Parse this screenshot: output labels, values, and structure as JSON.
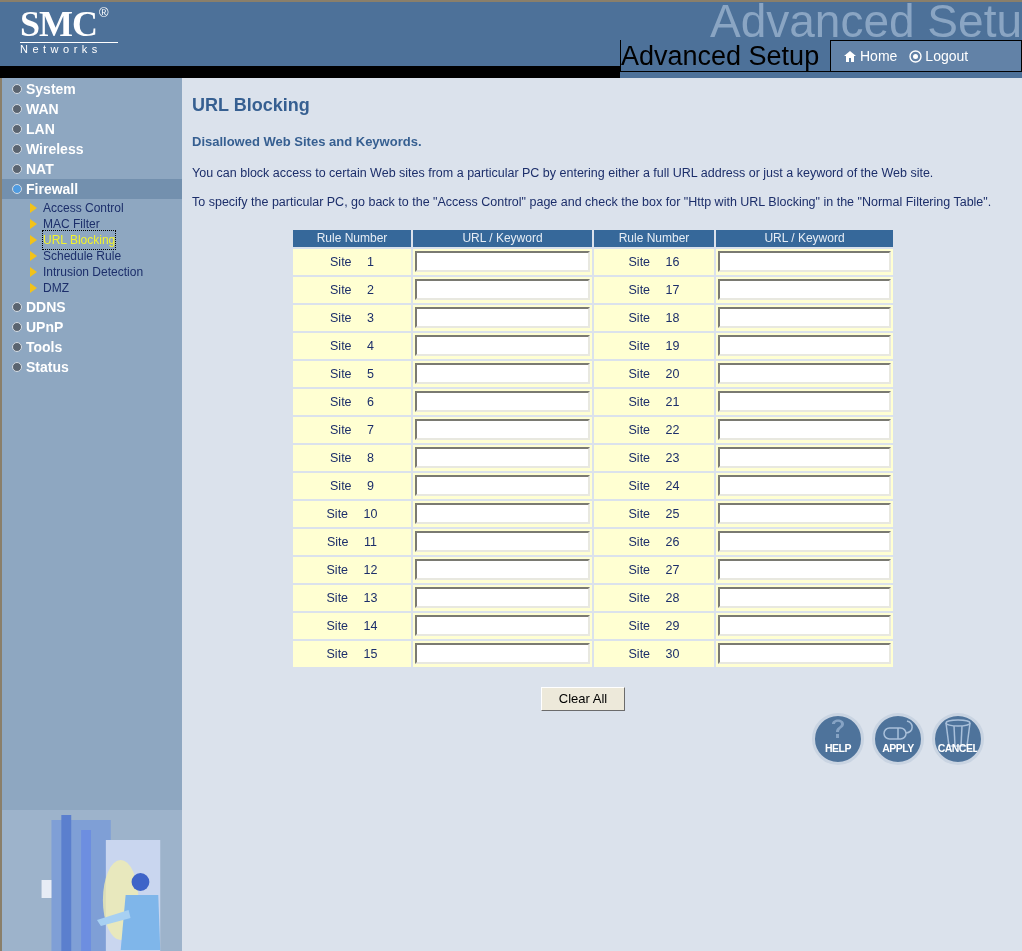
{
  "header": {
    "logo": "SMC",
    "logo_mark": "®",
    "logo_sub": "Networks",
    "backdrop_title": "Advanced Setu",
    "title": "Advanced Setup",
    "links": [
      {
        "label": "Home",
        "kind": "home"
      },
      {
        "label": "Logout",
        "kind": "logout"
      }
    ]
  },
  "sidebar": {
    "items": [
      {
        "label": "System",
        "selected": false
      },
      {
        "label": "WAN",
        "selected": false
      },
      {
        "label": "LAN",
        "selected": false
      },
      {
        "label": "Wireless",
        "selected": false
      },
      {
        "label": "NAT",
        "selected": false
      },
      {
        "label": "Firewall",
        "selected": true,
        "children": [
          {
            "label": "Access Control",
            "selected": false
          },
          {
            "label": "MAC Filter",
            "selected": false
          },
          {
            "label": "URL Blocking",
            "selected": true
          },
          {
            "label": "Schedule Rule",
            "selected": false
          },
          {
            "label": "Intrusion Detection",
            "selected": false
          },
          {
            "label": "DMZ",
            "selected": false
          }
        ]
      },
      {
        "label": "DDNS",
        "selected": false
      },
      {
        "label": "UPnP",
        "selected": false
      },
      {
        "label": "Tools",
        "selected": false
      },
      {
        "label": "Status",
        "selected": false
      }
    ]
  },
  "page": {
    "title": "URL Blocking",
    "subtitle": "Disallowed Web Sites and Keywords.",
    "paragraphs": [
      "You can block access to certain Web sites from a particular PC by entering either a full URL address or just a keyword of the Web site.",
      "To specify the particular PC, go back to the \"Access Control\" page and check the box for \"Http with URL Blocking\" in the \"Normal Filtering Table\"."
    ]
  },
  "table": {
    "columns": [
      "Rule Number",
      "URL / Keyword",
      "Rule Number",
      "URL / Keyword"
    ],
    "rows": [
      {
        "left": "Site 1",
        "right": "Site 16"
      },
      {
        "left": "Site 2",
        "right": "Site 17"
      },
      {
        "left": "Site 3",
        "right": "Site 18"
      },
      {
        "left": "Site 4",
        "right": "Site 19"
      },
      {
        "left": "Site 5",
        "right": "Site 20"
      },
      {
        "left": "Site 6",
        "right": "Site 21"
      },
      {
        "left": "Site 7",
        "right": "Site 22"
      },
      {
        "left": "Site 8",
        "right": "Site 23"
      },
      {
        "left": "Site 9",
        "right": "Site 24"
      },
      {
        "left": "Site 10",
        "right": "Site 25"
      },
      {
        "left": "Site 11",
        "right": "Site 26"
      },
      {
        "left": "Site 12",
        "right": "Site 27"
      },
      {
        "left": "Site 13",
        "right": "Site 28"
      },
      {
        "left": "Site 14",
        "right": "Site 29"
      },
      {
        "left": "Site 15",
        "right": "Site 30"
      }
    ]
  },
  "clear_button": "Clear All",
  "actions": [
    {
      "label": "HELP",
      "kind": "help"
    },
    {
      "label": "APPLY",
      "kind": "apply"
    },
    {
      "label": "CANCEL",
      "kind": "cancel"
    }
  ]
}
